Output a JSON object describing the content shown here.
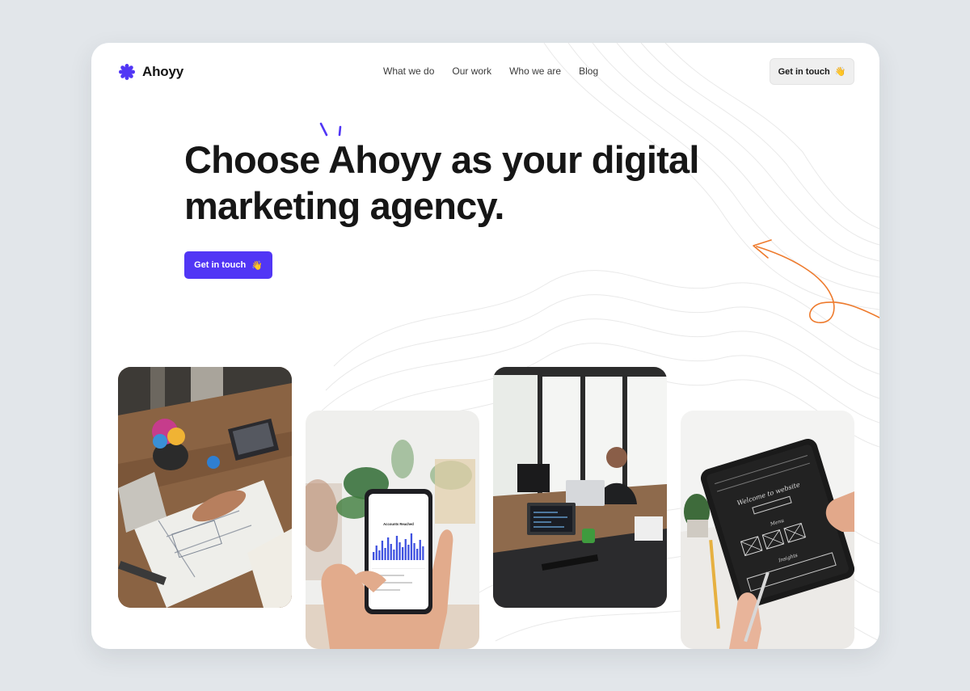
{
  "brand": {
    "name": "Ahoyy",
    "accent": "#5136f5",
    "doodle_color": "#ee7a2c"
  },
  "nav": {
    "items": [
      "What we do",
      "Our work",
      "Who we are",
      "Blog"
    ]
  },
  "header": {
    "cta_label": "Get in touch",
    "cta_emoji": "👋"
  },
  "hero": {
    "title_line1": "Choose Ahoyy as your digital",
    "title_line2": "marketing agency.",
    "cta_label": "Get in touch",
    "cta_emoji": "👋"
  },
  "gallery": [
    {
      "subject": "architect drawing on blueprint"
    },
    {
      "subject": "hand holding phone with analytics app"
    },
    {
      "subject": "man working in office"
    },
    {
      "subject": "hands holding tablet with wireframe sketch"
    }
  ],
  "phone_screen": {
    "title": "Accounts Reached"
  },
  "tablet_screen": {
    "headline": "Welcome to website",
    "section_label": "Menu",
    "footer_label": "Insights"
  }
}
